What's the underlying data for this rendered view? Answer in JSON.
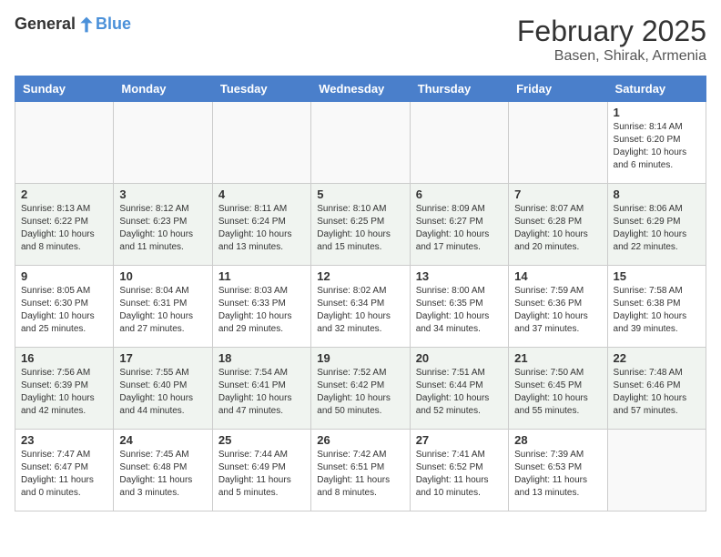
{
  "header": {
    "logo_general": "General",
    "logo_blue": "Blue",
    "month": "February 2025",
    "location": "Basen, Shirak, Armenia"
  },
  "days_of_week": [
    "Sunday",
    "Monday",
    "Tuesday",
    "Wednesday",
    "Thursday",
    "Friday",
    "Saturday"
  ],
  "weeks": [
    {
      "alt": false,
      "days": [
        {
          "num": "",
          "info": ""
        },
        {
          "num": "",
          "info": ""
        },
        {
          "num": "",
          "info": ""
        },
        {
          "num": "",
          "info": ""
        },
        {
          "num": "",
          "info": ""
        },
        {
          "num": "",
          "info": ""
        },
        {
          "num": "1",
          "info": "Sunrise: 8:14 AM\nSunset: 6:20 PM\nDaylight: 10 hours\nand 6 minutes."
        }
      ]
    },
    {
      "alt": true,
      "days": [
        {
          "num": "2",
          "info": "Sunrise: 8:13 AM\nSunset: 6:22 PM\nDaylight: 10 hours\nand 8 minutes."
        },
        {
          "num": "3",
          "info": "Sunrise: 8:12 AM\nSunset: 6:23 PM\nDaylight: 10 hours\nand 11 minutes."
        },
        {
          "num": "4",
          "info": "Sunrise: 8:11 AM\nSunset: 6:24 PM\nDaylight: 10 hours\nand 13 minutes."
        },
        {
          "num": "5",
          "info": "Sunrise: 8:10 AM\nSunset: 6:25 PM\nDaylight: 10 hours\nand 15 minutes."
        },
        {
          "num": "6",
          "info": "Sunrise: 8:09 AM\nSunset: 6:27 PM\nDaylight: 10 hours\nand 17 minutes."
        },
        {
          "num": "7",
          "info": "Sunrise: 8:07 AM\nSunset: 6:28 PM\nDaylight: 10 hours\nand 20 minutes."
        },
        {
          "num": "8",
          "info": "Sunrise: 8:06 AM\nSunset: 6:29 PM\nDaylight: 10 hours\nand 22 minutes."
        }
      ]
    },
    {
      "alt": false,
      "days": [
        {
          "num": "9",
          "info": "Sunrise: 8:05 AM\nSunset: 6:30 PM\nDaylight: 10 hours\nand 25 minutes."
        },
        {
          "num": "10",
          "info": "Sunrise: 8:04 AM\nSunset: 6:31 PM\nDaylight: 10 hours\nand 27 minutes."
        },
        {
          "num": "11",
          "info": "Sunrise: 8:03 AM\nSunset: 6:33 PM\nDaylight: 10 hours\nand 29 minutes."
        },
        {
          "num": "12",
          "info": "Sunrise: 8:02 AM\nSunset: 6:34 PM\nDaylight: 10 hours\nand 32 minutes."
        },
        {
          "num": "13",
          "info": "Sunrise: 8:00 AM\nSunset: 6:35 PM\nDaylight: 10 hours\nand 34 minutes."
        },
        {
          "num": "14",
          "info": "Sunrise: 7:59 AM\nSunset: 6:36 PM\nDaylight: 10 hours\nand 37 minutes."
        },
        {
          "num": "15",
          "info": "Sunrise: 7:58 AM\nSunset: 6:38 PM\nDaylight: 10 hours\nand 39 minutes."
        }
      ]
    },
    {
      "alt": true,
      "days": [
        {
          "num": "16",
          "info": "Sunrise: 7:56 AM\nSunset: 6:39 PM\nDaylight: 10 hours\nand 42 minutes."
        },
        {
          "num": "17",
          "info": "Sunrise: 7:55 AM\nSunset: 6:40 PM\nDaylight: 10 hours\nand 44 minutes."
        },
        {
          "num": "18",
          "info": "Sunrise: 7:54 AM\nSunset: 6:41 PM\nDaylight: 10 hours\nand 47 minutes."
        },
        {
          "num": "19",
          "info": "Sunrise: 7:52 AM\nSunset: 6:42 PM\nDaylight: 10 hours\nand 50 minutes."
        },
        {
          "num": "20",
          "info": "Sunrise: 7:51 AM\nSunset: 6:44 PM\nDaylight: 10 hours\nand 52 minutes."
        },
        {
          "num": "21",
          "info": "Sunrise: 7:50 AM\nSunset: 6:45 PM\nDaylight: 10 hours\nand 55 minutes."
        },
        {
          "num": "22",
          "info": "Sunrise: 7:48 AM\nSunset: 6:46 PM\nDaylight: 10 hours\nand 57 minutes."
        }
      ]
    },
    {
      "alt": false,
      "days": [
        {
          "num": "23",
          "info": "Sunrise: 7:47 AM\nSunset: 6:47 PM\nDaylight: 11 hours\nand 0 minutes."
        },
        {
          "num": "24",
          "info": "Sunrise: 7:45 AM\nSunset: 6:48 PM\nDaylight: 11 hours\nand 3 minutes."
        },
        {
          "num": "25",
          "info": "Sunrise: 7:44 AM\nSunset: 6:49 PM\nDaylight: 11 hours\nand 5 minutes."
        },
        {
          "num": "26",
          "info": "Sunrise: 7:42 AM\nSunset: 6:51 PM\nDaylight: 11 hours\nand 8 minutes."
        },
        {
          "num": "27",
          "info": "Sunrise: 7:41 AM\nSunset: 6:52 PM\nDaylight: 11 hours\nand 10 minutes."
        },
        {
          "num": "28",
          "info": "Sunrise: 7:39 AM\nSunset: 6:53 PM\nDaylight: 11 hours\nand 13 minutes."
        },
        {
          "num": "",
          "info": ""
        }
      ]
    }
  ]
}
